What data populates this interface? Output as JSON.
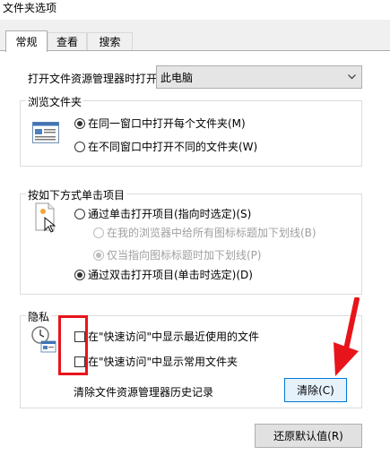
{
  "window": {
    "title": "文件夹选项"
  },
  "tabs": [
    {
      "label": "常规",
      "active": true
    },
    {
      "label": "查看",
      "active": false
    },
    {
      "label": "搜索",
      "active": false
    }
  ],
  "open_explorer": {
    "label": "打开文件资源管理器时打开:",
    "value": "此电脑"
  },
  "browse": {
    "legend": "浏览文件夹",
    "options": [
      {
        "label": "在同一窗口中打开每个文件夹(M)",
        "checked": true
      },
      {
        "label": "在不同窗口中打开不同的文件夹(W)",
        "checked": false
      }
    ]
  },
  "click": {
    "legend": "按如下方式单击项目",
    "single": {
      "label": "通过单击打开项目(指向时选定)(S)",
      "checked": false
    },
    "sub": [
      {
        "label": "在我的浏览器中给所有图标标题加下划线(B)",
        "checked": false,
        "disabled": true
      },
      {
        "label": "仅当指向图标标题时加下划线(P)",
        "checked": true,
        "disabled": true
      }
    ],
    "double": {
      "label": "通过双击打开项目(单击时选定)(D)",
      "checked": true
    }
  },
  "privacy": {
    "legend": "隐私",
    "recent_files": {
      "label": "在\"快速访问\"中显示最近使用的文件",
      "checked": false
    },
    "frequent_folders": {
      "label": "在\"快速访问\"中显示常用文件夹",
      "checked": false
    },
    "clear_history_label": "清除文件资源管理器历史记录",
    "clear_button": "清除(C)"
  },
  "restore_button": "还原默认值(R)",
  "annotation_color": "#e8141b"
}
